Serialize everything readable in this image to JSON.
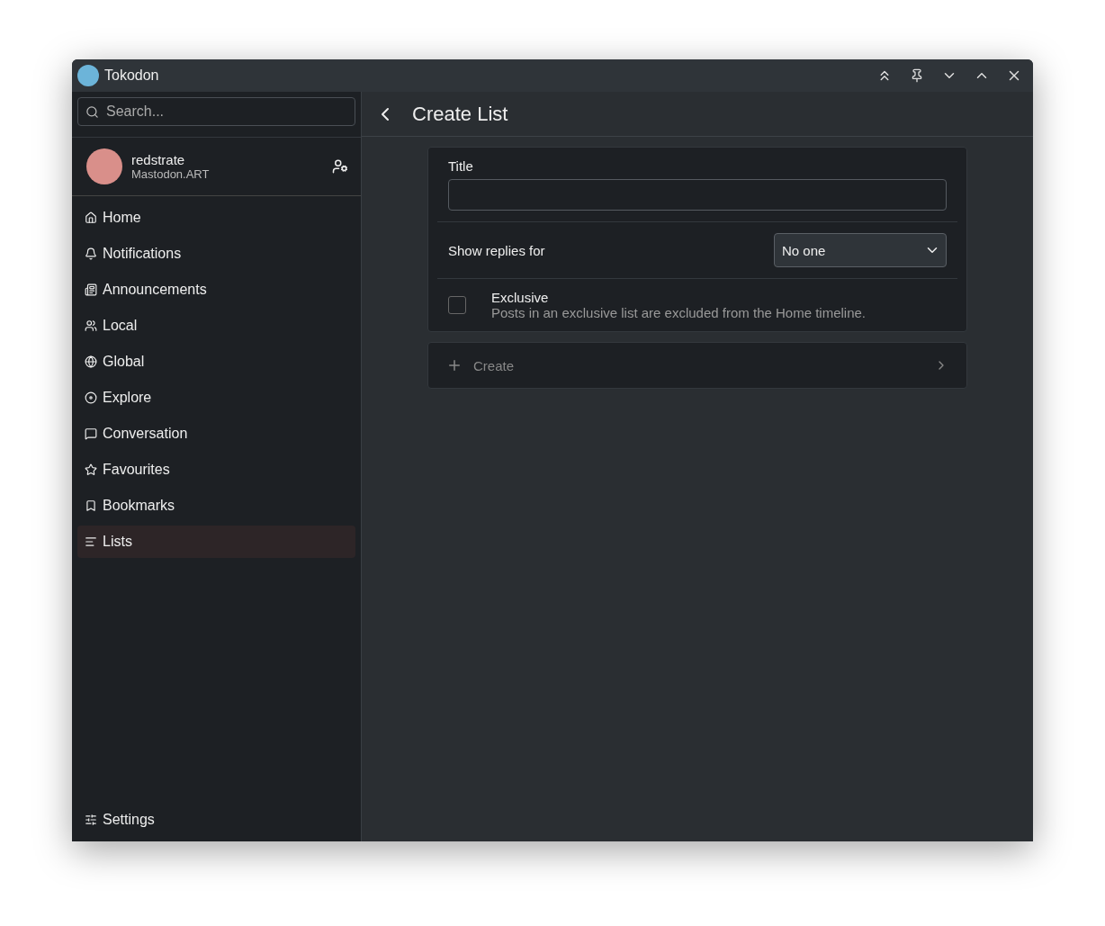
{
  "window": {
    "title": "Tokodon"
  },
  "search": {
    "placeholder": "Search..."
  },
  "account": {
    "name": "redstrate",
    "server": "Mastodon.ART"
  },
  "nav": [
    {
      "label": "Home",
      "selected": false
    },
    {
      "label": "Notifications",
      "selected": false
    },
    {
      "label": "Announcements",
      "selected": false
    },
    {
      "label": "Local",
      "selected": false
    },
    {
      "label": "Global",
      "selected": false
    },
    {
      "label": "Explore",
      "selected": false
    },
    {
      "label": "Conversation",
      "selected": false
    },
    {
      "label": "Favourites",
      "selected": false
    },
    {
      "label": "Bookmarks",
      "selected": false
    },
    {
      "label": "Lists",
      "selected": true
    }
  ],
  "settings": {
    "label": "Settings"
  },
  "page": {
    "title": "Create List"
  },
  "form": {
    "title_label": "Title",
    "replies_label": "Show replies for",
    "replies_value": "No one",
    "exclusive": {
      "label": "Exclusive",
      "description": "Posts in an exclusive list are excluded from the Home timeline.",
      "checked": false
    }
  },
  "create": {
    "label": "Create",
    "disabled": true
  }
}
